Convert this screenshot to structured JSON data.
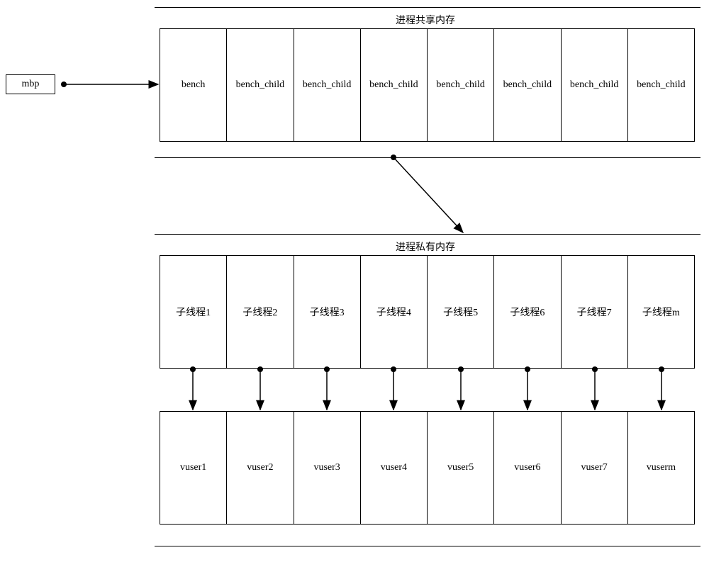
{
  "mbp": {
    "label": "mbp"
  },
  "shared": {
    "title": "进程共享内存",
    "cells": [
      "bench",
      "bench_child",
      "bench_child",
      "bench_child",
      "bench_child",
      "bench_child",
      "bench_child",
      "bench_child"
    ]
  },
  "private": {
    "title": "进程私有内存",
    "threads": [
      "子线程1",
      "子线程2",
      "子线程3",
      "子线程4",
      "子线程5",
      "子线程6",
      "子线程7",
      "子线程m"
    ],
    "vusers": [
      "vuser1",
      "vuser2",
      "vuser3",
      "vuser4",
      "vuser5",
      "vuser6",
      "vuser7",
      "vuserm"
    ]
  }
}
